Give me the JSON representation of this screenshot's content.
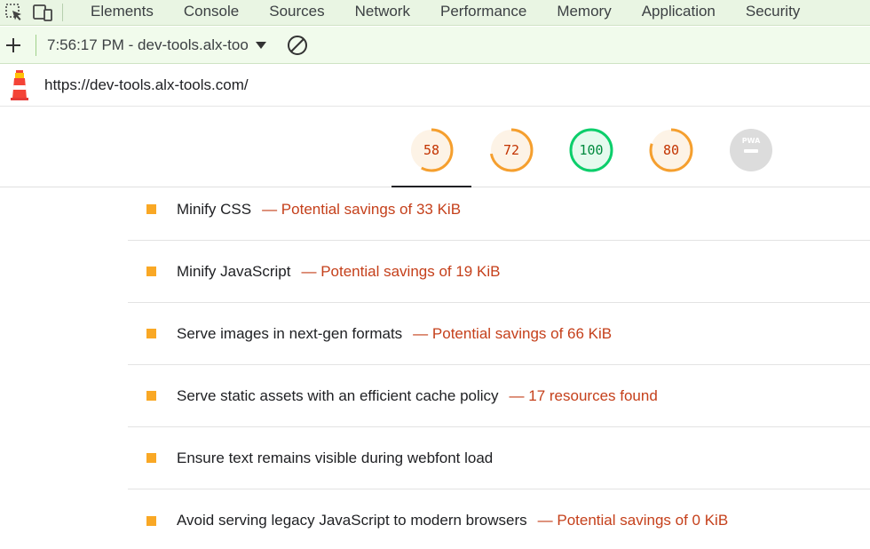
{
  "devtools": {
    "tabs": [
      "Elements",
      "Console",
      "Sources",
      "Network",
      "Performance",
      "Memory",
      "Application",
      "Security"
    ]
  },
  "toolbar": {
    "report_selector": "7:56:17 PM - dev-tools.alx-too"
  },
  "url_bar": {
    "url": "https://dev-tools.alx-tools.com/"
  },
  "scores": [
    {
      "value": "58",
      "fraction": 0.58,
      "status": "average"
    },
    {
      "value": "72",
      "fraction": 0.72,
      "status": "average"
    },
    {
      "value": "100",
      "fraction": 1.0,
      "status": "pass"
    },
    {
      "value": "80",
      "fraction": 0.8,
      "status": "average"
    },
    {
      "value": "PWA",
      "fraction": 0,
      "status": "na"
    }
  ],
  "colors": {
    "average": "#f59f2e",
    "average_fill": "#fdf3e6",
    "pass": "#0cce6b",
    "pass_fill": "#e5faee",
    "na": "#dcdcdc",
    "detail_text": "#c5401b",
    "marker": "#f9a825"
  },
  "audits": [
    {
      "title": "Minify CSS",
      "detail": "— Potential savings of 33 KiB"
    },
    {
      "title": "Minify JavaScript",
      "detail": "— Potential savings of 19 KiB"
    },
    {
      "title": "Serve images in next-gen formats",
      "detail": "— Potential savings of 66 KiB"
    },
    {
      "title": "Serve static assets with an efficient cache policy",
      "detail": "— 17 resources found"
    },
    {
      "title": "Ensure text remains visible during webfont load",
      "detail": ""
    },
    {
      "title": "Avoid serving legacy JavaScript to modern browsers",
      "detail": "— Potential savings of 0 KiB"
    }
  ]
}
